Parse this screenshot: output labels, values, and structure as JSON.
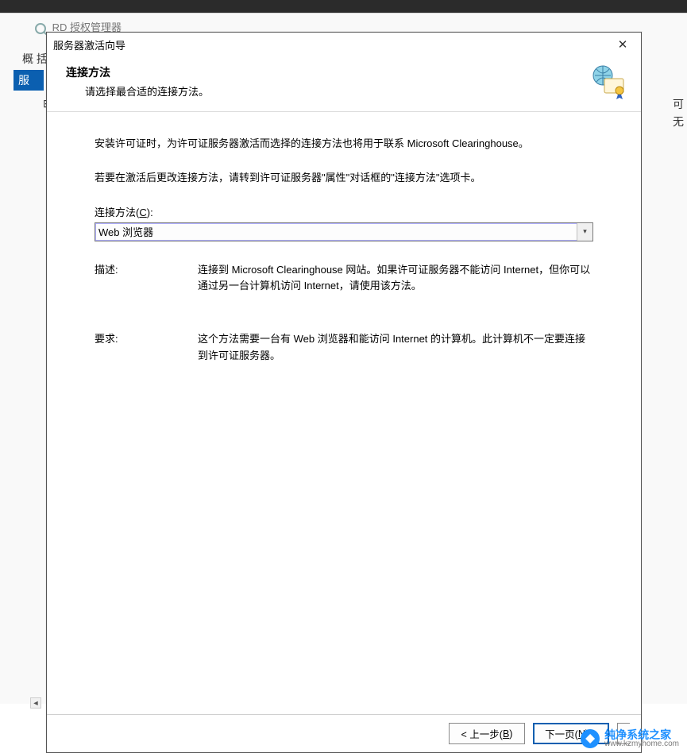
{
  "background": {
    "rd_bar_text": "RD 授权管理器",
    "side_text": "概 括",
    "side_tab": "服",
    "tree_minus": "⊟",
    "right_clip_line1": "可",
    "right_clip_line2": "无"
  },
  "wizard": {
    "title": "服务器激活向导",
    "header": {
      "heading": "连接方法",
      "sub": "请选择最合适的连接方法。"
    },
    "body": {
      "para1": "安装许可证时，为许可证服务器激活而选择的连接方法也将用于联系 Microsoft Clearinghouse。",
      "para2": "若要在激活后更改连接方法，请转到许可证服务器\"属性\"对话框的\"连接方法\"选项卡。",
      "connect_label_prefix": "连接方法(",
      "connect_label_key": "C",
      "connect_label_suffix": "):",
      "combo_value": "Web 浏览器",
      "desc_label": "描述:",
      "desc_text": "连接到 Microsoft Clearinghouse 网站。如果许可证服务器不能访问 Internet，但你可以通过另一台计算机访问 Internet，请使用该方法。",
      "req_label": "要求:",
      "req_text": "这个方法需要一台有 Web 浏览器和能访问 Internet 的计算机。此计算机不一定要连接到许可证服务器。"
    },
    "footer": {
      "back_prefix": "< 上一步(",
      "back_key": "B",
      "back_suffix": ")",
      "next_prefix": "下一页(",
      "next_key": "N",
      "next_suffix": ") >"
    }
  },
  "watermark": {
    "cn": "纯净系统之家",
    "en": "www.kzmyhome.com"
  }
}
